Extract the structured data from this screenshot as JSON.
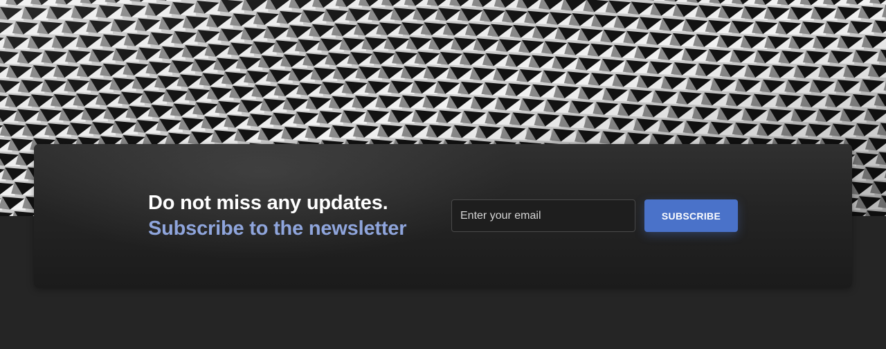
{
  "hero": {
    "image_description_icon": "architecture-pattern-image"
  },
  "newsletter": {
    "headline_line1": "Do not miss any updates.",
    "headline_line2": "Subscribe to the newsletter",
    "email_placeholder": "Enter your email",
    "email_value": "",
    "subscribe_label": "SUBSCRIBE"
  },
  "colors": {
    "accent": "#4a72c9",
    "accent_text": "#8fa5dc",
    "background": "#252525"
  }
}
